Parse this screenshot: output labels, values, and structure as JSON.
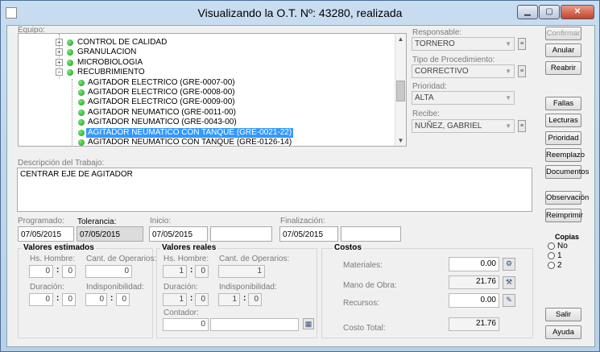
{
  "window": {
    "title": "Visualizando la O.T. Nº: 43280, realizada"
  },
  "equipo": {
    "label": "Equipo:",
    "tree": [
      {
        "label": "CONTROL DE CALIDAD",
        "level": 1,
        "expander": "+"
      },
      {
        "label": "GRANULACION",
        "level": 1,
        "expander": "+"
      },
      {
        "label": "MICROBIOLOGIA",
        "level": 1,
        "expander": "+"
      },
      {
        "label": "RECUBRIMIENTO",
        "level": 1,
        "expander": "−"
      },
      {
        "label": "AGITADOR ELECTRICO (GRE-0007-00)",
        "level": 2
      },
      {
        "label": "AGITADOR ELECTRICO (GRE-0008-00)",
        "level": 2
      },
      {
        "label": "AGITADOR ELECTRICO (GRE-0009-00)",
        "level": 2
      },
      {
        "label": "AGITADOR NEUMATICO (GRE-0011-00)",
        "level": 2
      },
      {
        "label": "AGITADOR NEUMATICO (GRE-0043-00)",
        "level": 2
      },
      {
        "label": "AGITADOR NEUMATICO CON TANQUE (GRE-0021-22)",
        "level": 2,
        "selected": true
      },
      {
        "label": "AGITADOR NEUMATICO CON TANQUE (GRE-0126-14)",
        "level": 2
      }
    ]
  },
  "responsable": {
    "label": "Responsable:",
    "value": "TORNERO"
  },
  "tipo": {
    "label": "Tipo de Procedimiento:",
    "value": "CORRECTIVO"
  },
  "prioridad": {
    "label": "Prioridad:",
    "value": "ALTA"
  },
  "recibe": {
    "label": "Recibe:",
    "value": "NUÑEZ, GABRIEL"
  },
  "descripcion": {
    "label": "Descripción del Trabajo:",
    "value": "CENTRAR EJE DE AGITADOR"
  },
  "fechas": {
    "programado_label": "Programado:",
    "programado": "07/05/2015",
    "tolerancia_label": "Tolerancia:",
    "tolerancia": "07/05/2015",
    "inicio_label": "Inicio:",
    "inicio": "07/05/2015",
    "inicio_hora": "",
    "finalizacion_label": "Finalización:",
    "finalizacion": "07/05/2015",
    "finalizacion_hora": ""
  },
  "estimados": {
    "title": "Valores estimados",
    "hs_label": "Hs. Hombre:",
    "hs_h": "0",
    "hs_m": "0",
    "cant_label": "Cant. de Operarios:",
    "cant": "0",
    "dur_label": "Duración:",
    "dur_h": "0",
    "dur_m": "0",
    "indisp_label": "Indisponibilidad:",
    "indisp_h": "0",
    "indisp_m": "0"
  },
  "reales": {
    "title": "Valores reales",
    "hs_label": "Hs. Hombre:",
    "hs_h": "1",
    "hs_m": "0",
    "cant_label": "Cant. de Operarios:",
    "cant": "1",
    "dur_label": "Duración:",
    "dur_h": "1",
    "dur_m": "0",
    "indisp_label": "Indisponibilidad:",
    "indisp_h": "1",
    "indisp_m": "0",
    "contador_label": "Contador:",
    "contador": "0",
    "contador_extra": ""
  },
  "costos": {
    "title": "Costos",
    "materiales_label": "Materiales:",
    "materiales": "0.00",
    "mano_label": "Mano de Obra:",
    "mano": "21.76",
    "recursos_label": "Recursos:",
    "recursos": "0.00",
    "total_label": "Costo Total:",
    "total": "21.76"
  },
  "buttons": {
    "confirmar": "Confirmar",
    "anular": "Anular",
    "reabrir": "Reabrir",
    "fallas": "Fallas",
    "lecturas": "Lecturas",
    "prioridad": "Prioridad",
    "reemplazo": "Reemplazo",
    "documentos": "Documentos",
    "observacion": "Observación",
    "reimprimir": "Reimprimir",
    "salir": "Salir",
    "ayuda": "Ayuda"
  },
  "copias": {
    "title": "Copias",
    "options": [
      "No",
      "1",
      "2"
    ]
  }
}
